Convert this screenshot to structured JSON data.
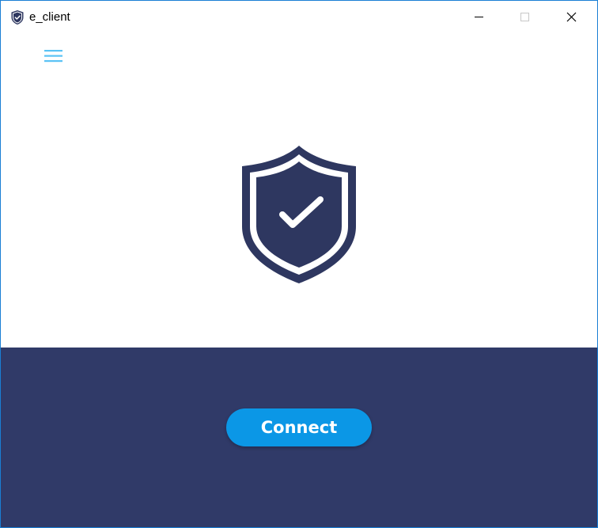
{
  "window": {
    "title": "e_client",
    "app_icon": "shield-icon",
    "controls": {
      "minimize_icon": "minimize-icon",
      "maximize_icon": "maximize-icon",
      "close_icon": "close-icon"
    }
  },
  "toolbar": {
    "menu_icon": "hamburger-menu-icon"
  },
  "hero": {
    "status_icon": "shield-check-icon"
  },
  "bottom": {
    "connect_label": "Connect"
  },
  "colors": {
    "window_border": "#1a7fd4",
    "menu_accent": "#5bc3f5",
    "shield": "#2e3760",
    "panel_background": "#303a68",
    "button_background": "#0b97e6",
    "button_text": "#ffffff"
  }
}
